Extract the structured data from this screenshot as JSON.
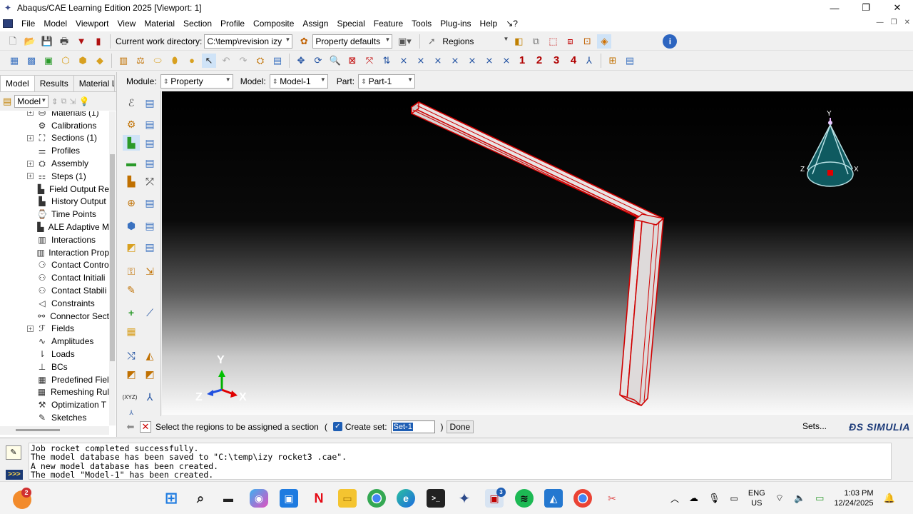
{
  "window": {
    "title": "Abaqus/CAE Learning Edition 2025 [Viewport: 1]",
    "icon": "abaqus-app-icon",
    "minimize": "—",
    "maximize": "❐",
    "close": "✕"
  },
  "menu": {
    "items": [
      "File",
      "Model",
      "Viewport",
      "View",
      "Material",
      "Section",
      "Profile",
      "Composite",
      "Assign",
      "Special",
      "Feature",
      "Tools",
      "Plug-ins",
      "Help",
      "↘?"
    ]
  },
  "toolbar": {
    "cwd_label": "Current work directory:",
    "cwd_value": "C:\\temp\\revision izy",
    "property_defaults": "Property defaults",
    "selection_filter": "Regions",
    "num1": "1",
    "num2": "2",
    "num3": "3",
    "num4": "4"
  },
  "left_panel": {
    "tabs": [
      "Model",
      "Results",
      "Material Lib"
    ],
    "model_combo": "Model",
    "tree_items": [
      {
        "label": "Materials (1)",
        "expand": "+",
        "icon": "materials-icon"
      },
      {
        "label": "Calibrations",
        "expand": "",
        "icon": "calibrations-icon"
      },
      {
        "label": "Sections (1)",
        "expand": "+",
        "icon": "sections-icon"
      },
      {
        "label": "Profiles",
        "expand": "",
        "icon": "profiles-icon"
      },
      {
        "label": "Assembly",
        "expand": "+",
        "icon": "assembly-icon"
      },
      {
        "label": "Steps (1)",
        "expand": "+",
        "icon": "steps-icon"
      },
      {
        "label": "Field Output Re",
        "expand": "",
        "icon": "field-output-icon"
      },
      {
        "label": "History Output",
        "expand": "",
        "icon": "history-output-icon"
      },
      {
        "label": "Time Points",
        "expand": "",
        "icon": "time-points-icon"
      },
      {
        "label": "ALE Adaptive M",
        "expand": "",
        "icon": "ale-adaptive-icon"
      },
      {
        "label": "Interactions",
        "expand": "",
        "icon": "interactions-icon"
      },
      {
        "label": "Interaction Prop",
        "expand": "",
        "icon": "interaction-prop-icon"
      },
      {
        "label": "Contact Contro",
        "expand": "",
        "icon": "contact-controls-icon"
      },
      {
        "label": "Contact Initiali",
        "expand": "",
        "icon": "contact-init-icon"
      },
      {
        "label": "Contact Stabili",
        "expand": "",
        "icon": "contact-stab-icon"
      },
      {
        "label": "Constraints",
        "expand": "",
        "icon": "constraints-icon"
      },
      {
        "label": "Connector Sect",
        "expand": "",
        "icon": "connector-section-icon"
      },
      {
        "label": "Fields",
        "expand": "+",
        "icon": "fields-icon"
      },
      {
        "label": "Amplitudes",
        "expand": "",
        "icon": "amplitudes-icon"
      },
      {
        "label": "Loads",
        "expand": "",
        "icon": "loads-icon"
      },
      {
        "label": "BCs",
        "expand": "",
        "icon": "bcs-icon"
      },
      {
        "label": "Predefined Fiel",
        "expand": "",
        "icon": "predefined-field-icon"
      },
      {
        "label": "Remeshing Rul",
        "expand": "",
        "icon": "remeshing-icon"
      },
      {
        "label": "Optimization T",
        "expand": "",
        "icon": "optimization-icon"
      },
      {
        "label": "Sketches",
        "expand": "",
        "icon": "sketches-icon"
      }
    ]
  },
  "module_bar": {
    "module_label": "Module:",
    "module_value": "Property",
    "model_label": "Model:",
    "model_value": "Model-1",
    "part_label": "Part:",
    "part_value": "Part-1"
  },
  "viewport": {
    "triad_y": "Y",
    "triad_z": "Z",
    "triad_x": "X",
    "view_cube_y": "Y",
    "view_cube_z": "Z",
    "view_cube_x": "X"
  },
  "prompt": {
    "text": "Select the regions to be assigned a section",
    "open_paren": "(",
    "create_set_label": "Create set:",
    "set_value": "Set-1",
    "close_paren": ")",
    "done": "Done",
    "sets": "Sets...",
    "brand": "ĐS SIMULIA"
  },
  "messages": {
    "lines": "Job rocket completed successfully.\nThe model database has been saved to \"C:\\temp\\izy rocket3 .cae\".\nA new model database has been created.\nThe model \"Model-1\" has been created."
  },
  "taskbar": {
    "badge": "2",
    "lang_top": "ENG",
    "lang_bottom": "US",
    "time": "1:03 PM",
    "date": "12/24/2025",
    "abaqus_badge": "3"
  }
}
